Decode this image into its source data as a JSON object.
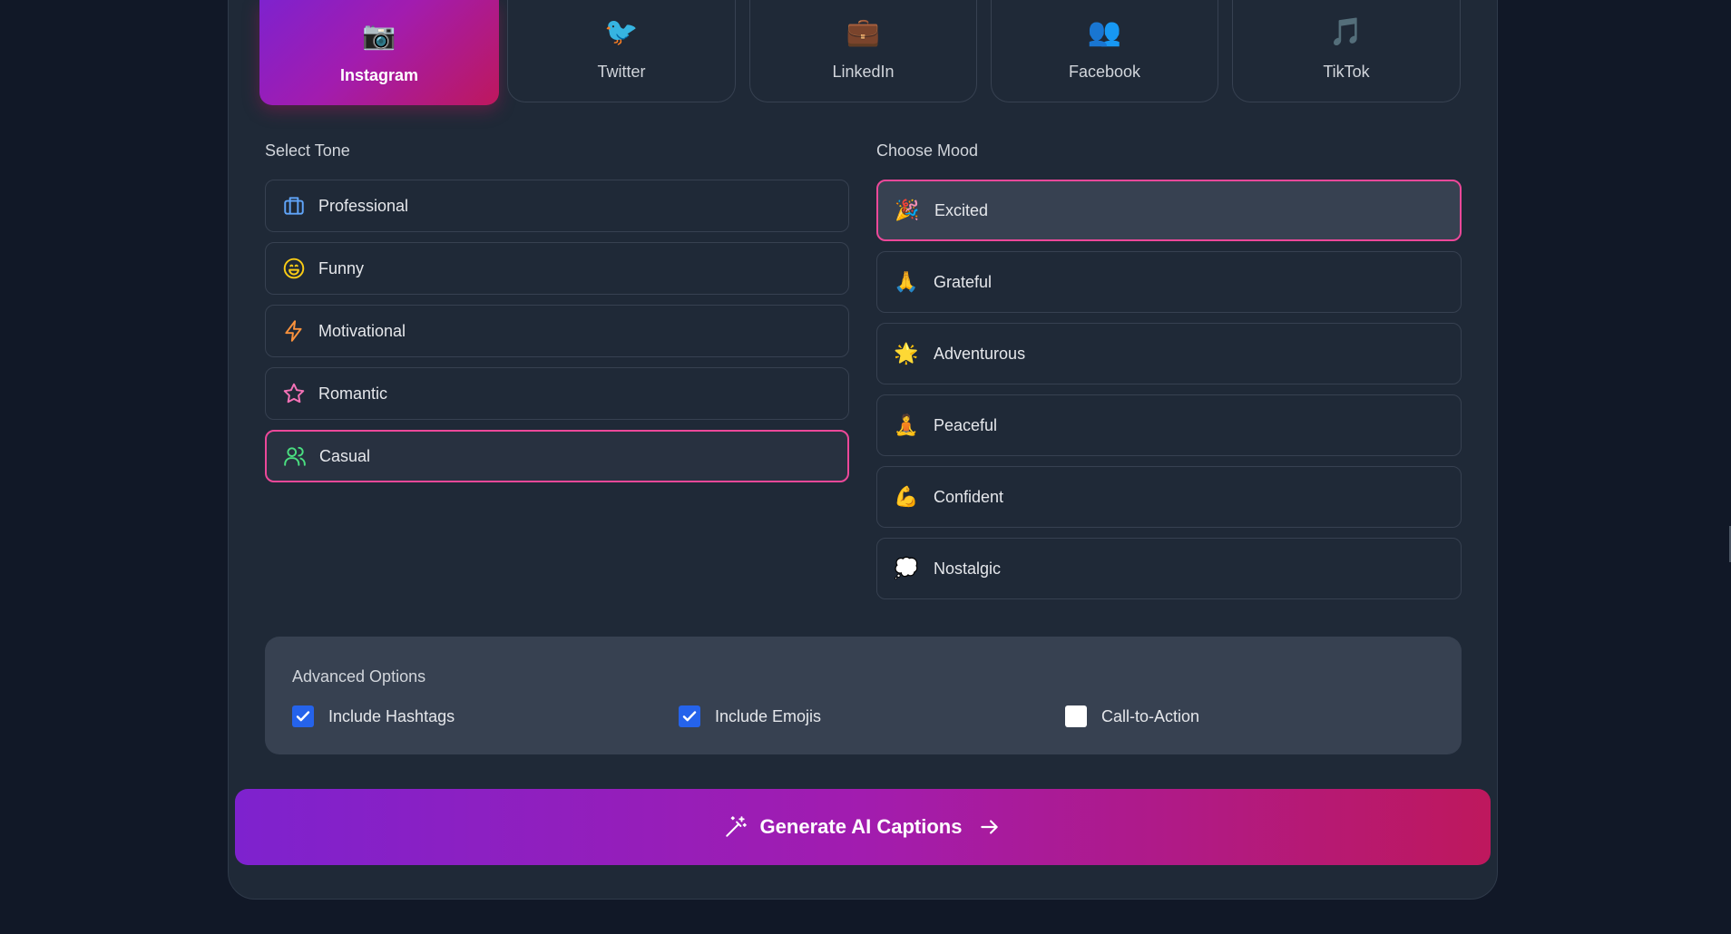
{
  "platforms": [
    {
      "label": "Instagram",
      "icon": "📷",
      "icon_name": "camera-icon"
    },
    {
      "label": "Twitter",
      "icon": "🐦",
      "icon_name": "bird-icon"
    },
    {
      "label": "LinkedIn",
      "icon": "💼",
      "icon_name": "briefcase-icon"
    },
    {
      "label": "Facebook",
      "icon": "👥",
      "icon_name": "people-icon"
    },
    {
      "label": "TikTok",
      "icon": "🎵",
      "icon_name": "music-note-icon"
    }
  ],
  "active_platform": "Instagram",
  "tone": {
    "title": "Select Tone",
    "items": [
      {
        "label": "Professional",
        "icon_name": "briefcase-icon",
        "color": "#60a5fa"
      },
      {
        "label": "Funny",
        "icon_name": "laugh-icon",
        "color": "#facc15"
      },
      {
        "label": "Motivational",
        "icon_name": "lightning-icon",
        "color": "#fb923c"
      },
      {
        "label": "Romantic",
        "icon_name": "star-icon",
        "color": "#f472b6"
      },
      {
        "label": "Casual",
        "icon_name": "users-icon",
        "color": "#4ade80"
      }
    ],
    "selected": "Casual"
  },
  "mood": {
    "title": "Choose Mood",
    "items": [
      {
        "label": "Excited",
        "emoji": "🎉"
      },
      {
        "label": "Grateful",
        "emoji": "🙏"
      },
      {
        "label": "Adventurous",
        "emoji": "🌟"
      },
      {
        "label": "Peaceful",
        "emoji": "🧘"
      },
      {
        "label": "Confident",
        "emoji": "💪"
      },
      {
        "label": "Nostalgic",
        "emoji": "💭"
      }
    ],
    "selected": "Excited"
  },
  "advanced": {
    "title": "Advanced Options",
    "options": [
      {
        "label": "Include Hashtags",
        "checked": true
      },
      {
        "label": "Include Emojis",
        "checked": true
      },
      {
        "label": "Call-to-Action",
        "checked": false
      }
    ]
  },
  "generate": {
    "label": "Generate AI Captions"
  },
  "colors": {
    "background": "#111827",
    "card": "#1f2937",
    "accent_pink": "#ec4899",
    "gradient_start": "#7e22ce",
    "gradient_end": "#be185d",
    "checkbox": "#2563eb"
  }
}
